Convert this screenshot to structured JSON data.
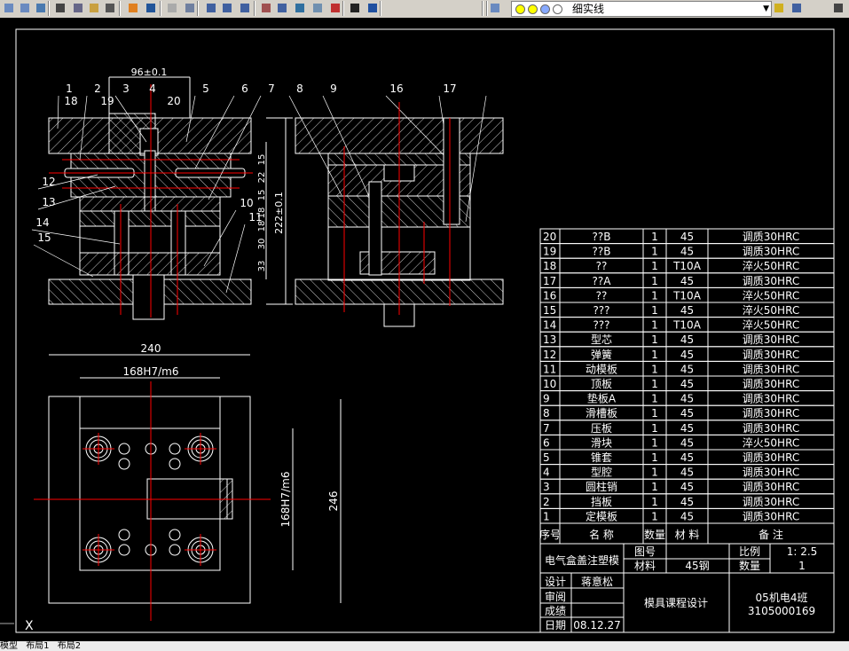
{
  "toolbar": {
    "icons": [
      "pan-icon",
      "plot-icon",
      "browser-icon",
      "cut-icon",
      "copy-icon",
      "paste-icon",
      "match-properties-icon",
      "block-icon",
      "undo-icon",
      "redo-icon",
      "realtime-pan-icon",
      "zoom-realtime-icon",
      "zoom-window-icon",
      "zoom-previous-icon",
      "properties-icon",
      "design-center-icon",
      "tool-palettes-icon",
      "sheet-set-icon",
      "markup-icon",
      "calculator-icon",
      "help-icon"
    ],
    "layer_name": "细实线"
  },
  "colors": {
    "background": "#000000",
    "lines": "#ffffff",
    "centerlines": "#ff0000",
    "toolbar": "#d4d0c8"
  },
  "drawing": {
    "dims": {
      "top_width": "96±0.1",
      "height": "222±0.1",
      "plan_width": "240",
      "plan_inner": "168H7/m6",
      "plan_inner_v": "168H7/m6",
      "plan_height": "246",
      "stack": [
        "15",
        "22",
        "15",
        "18",
        "18",
        "30",
        "33"
      ]
    },
    "balloons_left": [
      "1",
      "2",
      "3",
      "4",
      "5",
      "6",
      "7",
      "18",
      "19",
      "20",
      "12",
      "13",
      "14",
      "15",
      "10",
      "11"
    ],
    "balloons_right": [
      "8",
      "9",
      "16",
      "17"
    ]
  },
  "bom": {
    "rows": [
      [
        "20",
        "??B",
        "1",
        "45",
        "调质30HRC"
      ],
      [
        "19",
        "??B",
        "1",
        "45",
        "调质30HRC"
      ],
      [
        "18",
        "??",
        "1",
        "T10A",
        "淬火50HRC"
      ],
      [
        "17",
        "??A",
        "1",
        "45",
        "调质30HRC"
      ],
      [
        "16",
        "??",
        "1",
        "T10A",
        "淬火50HRC"
      ],
      [
        "15",
        "???",
        "1",
        "45",
        "淬火50HRC"
      ],
      [
        "14",
        "???",
        "1",
        "T10A",
        "淬火50HRC"
      ],
      [
        "13",
        "型芯",
        "1",
        "45",
        "调质30HRC"
      ],
      [
        "12",
        "弹簧",
        "1",
        "45",
        "调质30HRC"
      ],
      [
        "11",
        "动模板",
        "1",
        "45",
        "调质30HRC"
      ],
      [
        "10",
        "顶板",
        "1",
        "45",
        "调质30HRC"
      ],
      [
        "9",
        "垫板A",
        "1",
        "45",
        "调质30HRC"
      ],
      [
        "8",
        "滑槽板",
        "1",
        "45",
        "调质30HRC"
      ],
      [
        "7",
        "压板",
        "1",
        "45",
        "调质30HRC"
      ],
      [
        "6",
        "滑块",
        "1",
        "45",
        "淬火50HRC"
      ],
      [
        "5",
        "锥套",
        "1",
        "45",
        "调质30HRC"
      ],
      [
        "4",
        "型腔",
        "1",
        "45",
        "调质30HRC"
      ],
      [
        "3",
        "圆柱销",
        "1",
        "45",
        "调质30HRC"
      ],
      [
        "2",
        "挡板",
        "1",
        "45",
        "调质30HRC"
      ],
      [
        "1",
        "定模板",
        "1",
        "45",
        "调质30HRC"
      ]
    ],
    "header": [
      "序号",
      "名 称",
      "数量",
      "材 料",
      "备  注"
    ]
  },
  "title_block": {
    "part_name": "电气盒盖注塑模",
    "label_drawing_no": "图号",
    "label_scale": "比例",
    "scale": "1: 2.5",
    "label_material": "材料",
    "material": "45钢",
    "label_quantity": "数量",
    "quantity": "1",
    "label_design": "设计",
    "designer": "蒋意松",
    "label_review": "审阅",
    "label_grade": "成绩",
    "label_date": "日期",
    "date": "08.12.27",
    "project": "模具课程设计",
    "class": "05机电4班",
    "student_id": "3105000169"
  },
  "ucs_label": "X",
  "tabs": [
    "模型",
    "布局1",
    "布局2"
  ]
}
